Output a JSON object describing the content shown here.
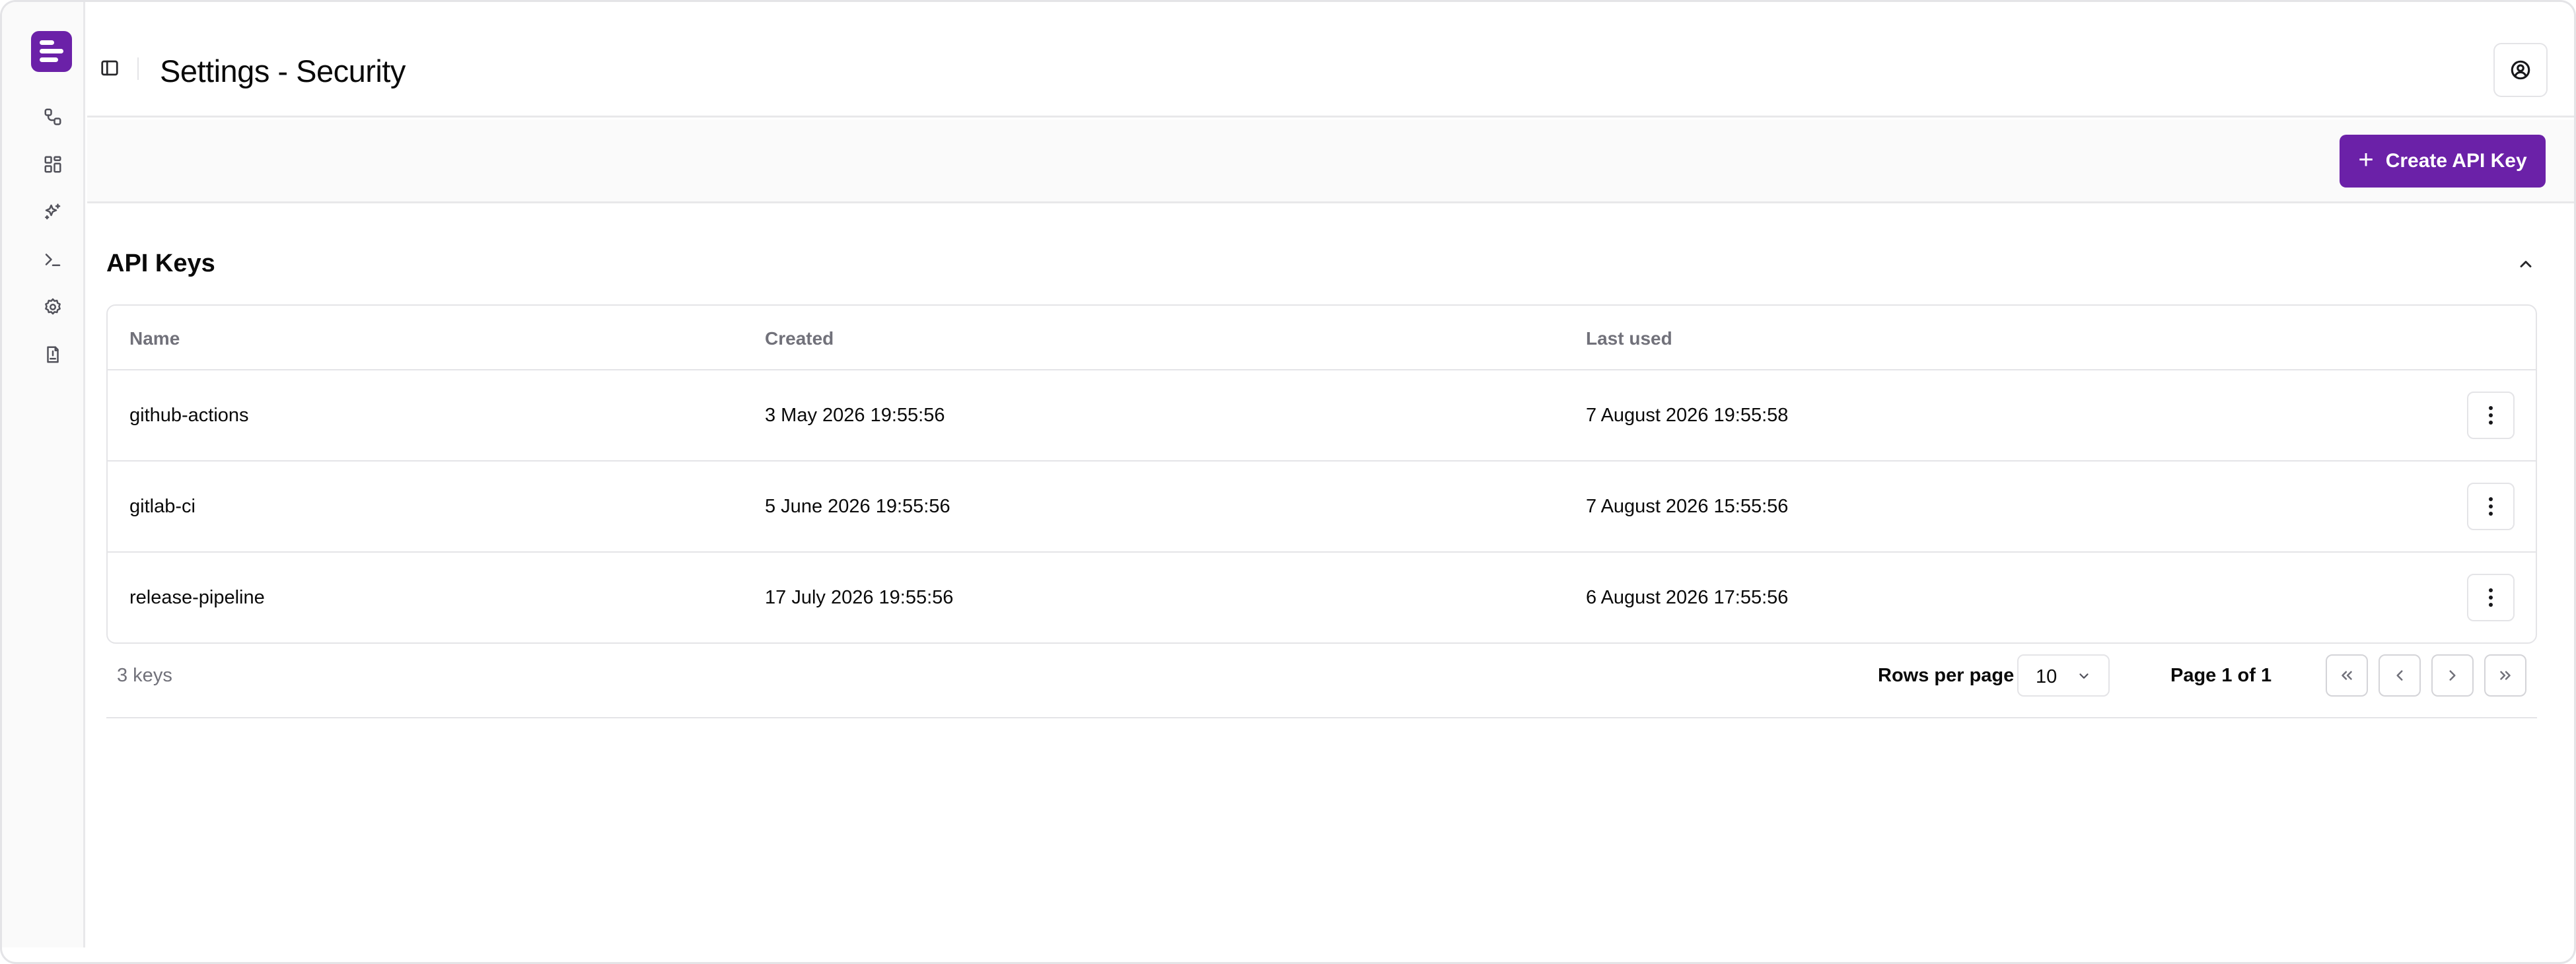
{
  "header": {
    "title": "Settings - Security"
  },
  "toolbar": {
    "create_label": "Create API Key"
  },
  "sidebar": {
    "items": [
      {
        "icon": "workflow-icon"
      },
      {
        "icon": "dashboard-icon"
      },
      {
        "icon": "sparkles-icon"
      },
      {
        "icon": "terminal-icon"
      },
      {
        "icon": "settings-gear-icon"
      },
      {
        "icon": "docs-icon"
      }
    ]
  },
  "section": {
    "title": "API Keys"
  },
  "table": {
    "columns": [
      "Name",
      "Created",
      "Last used"
    ],
    "rows": [
      {
        "name": "github-actions",
        "created": "3 May 2026 19:55:56",
        "last_used": "7 August 2026 19:55:58"
      },
      {
        "name": "gitlab-ci",
        "created": "5 June 2026 19:55:56",
        "last_used": "7 August 2026 15:55:56"
      },
      {
        "name": "release-pipeline",
        "created": "17 July 2026 19:55:56",
        "last_used": "6 August 2026 17:55:56"
      }
    ]
  },
  "footer": {
    "count": "3 keys",
    "rows_per_page_label": "Rows per page",
    "rows_per_page_value": "10",
    "page_label": "Page 1 of 1"
  },
  "colors": {
    "accent": "#6b21a8",
    "border": "#e4e4e7",
    "muted_text": "#71717a"
  }
}
